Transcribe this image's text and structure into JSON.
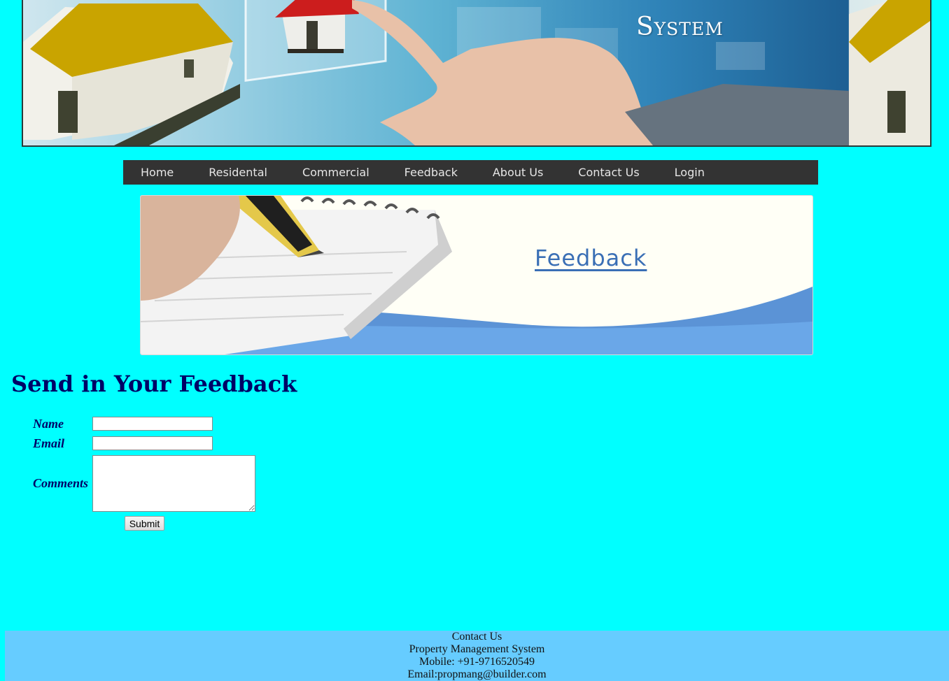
{
  "header": {
    "title": "System"
  },
  "nav": {
    "items": [
      "Home",
      "Residental",
      "Commercial",
      "Feedback",
      "About Us",
      "Contact Us",
      "Login"
    ]
  },
  "banner": {
    "word": "Feedback"
  },
  "page": {
    "title": "Send in Your Feedback"
  },
  "form": {
    "name_label": "Name",
    "name_value": "",
    "email_label": "Email",
    "email_value": "",
    "comments_label": "Comments",
    "comments_value": "",
    "submit_label": "Submit"
  },
  "footer": {
    "heading": "Contact Us",
    "company": "Property Management System",
    "mobile": "Mobile: +91-9716520549",
    "email": "Email:propmang@builder.com"
  },
  "colors": {
    "page_background": "#00ffff",
    "nav_background": "#333333",
    "heading": "#000066",
    "footer_background": "#66ccff"
  }
}
